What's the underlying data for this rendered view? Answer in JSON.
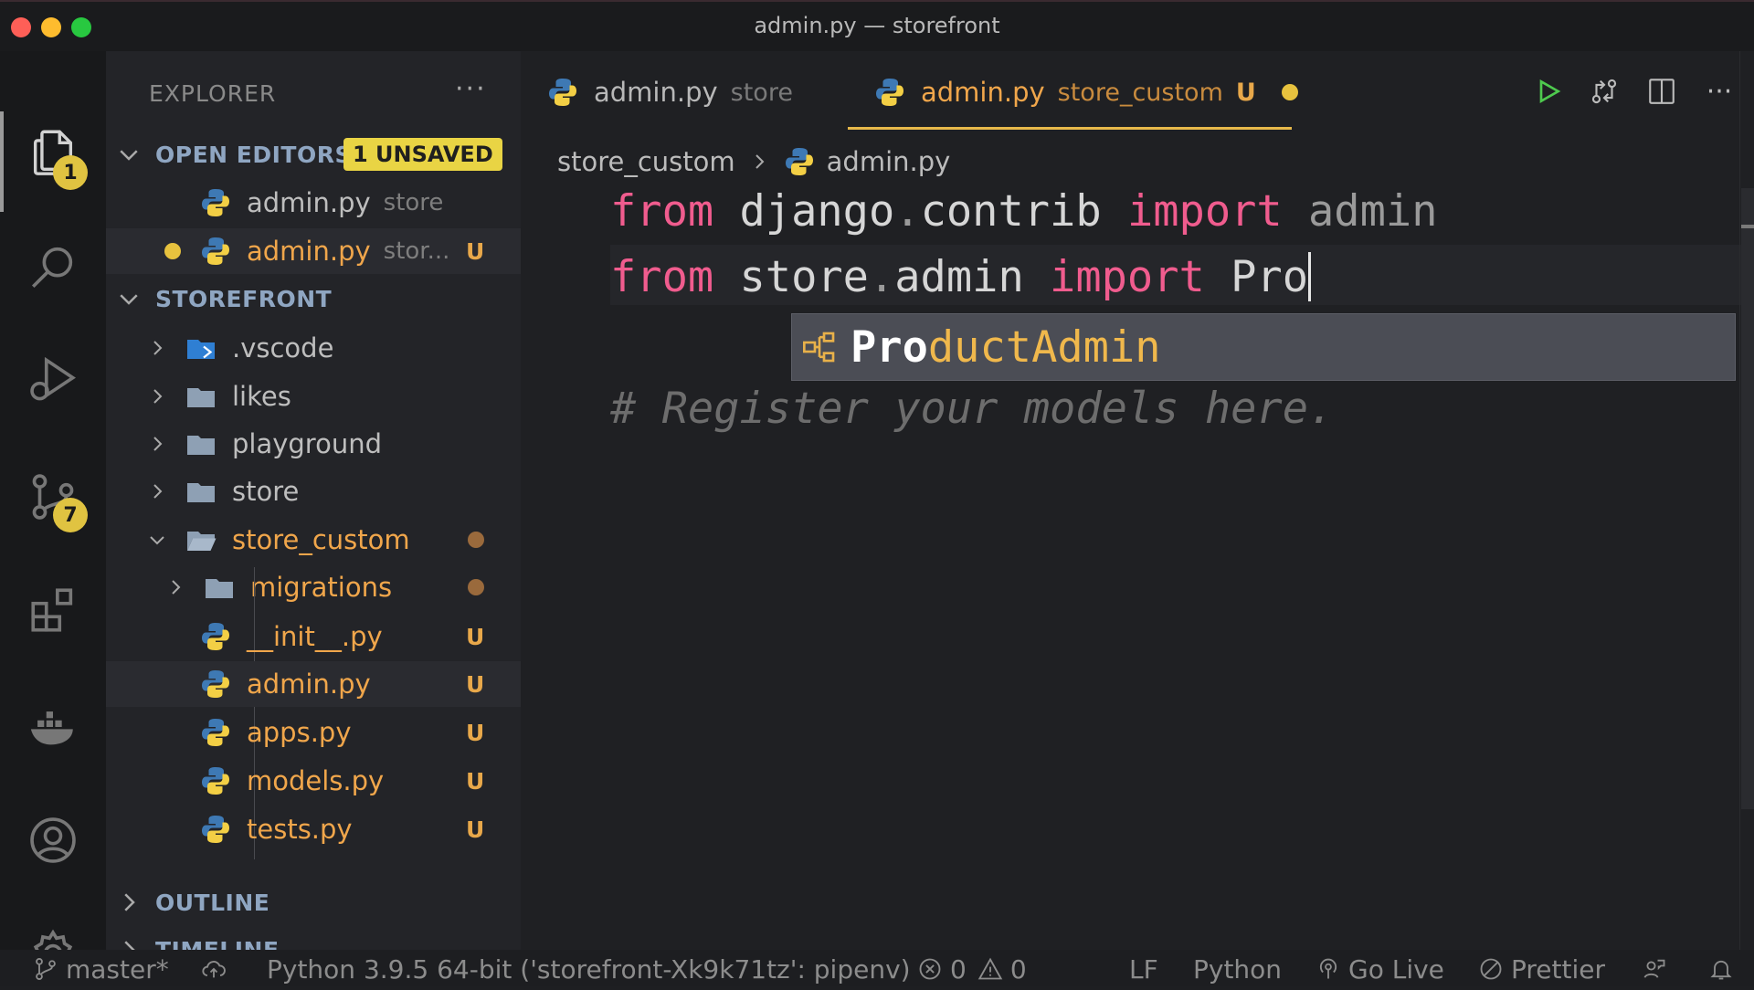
{
  "window": {
    "title": "admin.py — storefront"
  },
  "activity_bar": {
    "explorer_badge": "1",
    "scm_badge": "7",
    "icons": [
      "files-icon",
      "search-icon",
      "run-debug-icon",
      "source-control-icon",
      "extensions-icon",
      "docker-icon",
      "account-icon",
      "settings-gear-icon"
    ]
  },
  "explorer": {
    "title": "EXPLORER",
    "open_editors": {
      "label": "OPEN EDITORS",
      "badge": "1 UNSAVED",
      "items": [
        {
          "name": "admin.py",
          "desc": "store",
          "status": ""
        },
        {
          "name": "admin.py",
          "desc": "stor...",
          "status": "U"
        }
      ]
    },
    "workspace": {
      "label": "STOREFRONT",
      "folders": [
        ".vscode",
        "likes",
        "playground",
        "store",
        "store_custom"
      ],
      "store_custom_children": {
        "folder": "migrations",
        "files": [
          {
            "name": "__init__.py",
            "status": "U"
          },
          {
            "name": "admin.py",
            "status": "U"
          },
          {
            "name": "apps.py",
            "status": "U"
          },
          {
            "name": "models.py",
            "status": "U"
          },
          {
            "name": "tests.py",
            "status": "U"
          }
        ]
      }
    },
    "outline_label": "OUTLINE",
    "timeline_label": "TIMELINE"
  },
  "tabs": [
    {
      "name": "admin.py",
      "desc": "store",
      "active": false
    },
    {
      "name": "admin.py",
      "desc": "store_custom",
      "status": "U",
      "active": true,
      "unsaved": true
    }
  ],
  "breadcrumb": {
    "folder": "store_custom",
    "file": "admin.py"
  },
  "code": {
    "line1": {
      "kw1": "from",
      "mod_a": "django",
      "dot": ".",
      "mod_b": "contrib",
      "kw2": "import",
      "name": "admin"
    },
    "line2": {
      "kw1": "from",
      "mod_a": "store",
      "dot": ".",
      "mod_b": "admin",
      "kw2": "import",
      "typed": "Pro"
    },
    "comment": "# Register your models here."
  },
  "suggestion": {
    "match": "Pro",
    "rest": "ductAdmin"
  },
  "statusbar": {
    "branch": "master*",
    "interpreter": "Python 3.9.5 64-bit ('storefront-Xk9k71tz': pipenv)",
    "errors": "0",
    "warnings": "0",
    "eol": "LF",
    "language": "Python",
    "go_live": "Go Live",
    "prettier": "Prettier"
  },
  "colors": {
    "accent_modified": "#f0a64b",
    "keyword": "#f05c8e",
    "badge": "#e0c341",
    "run": "#4ec94e"
  }
}
